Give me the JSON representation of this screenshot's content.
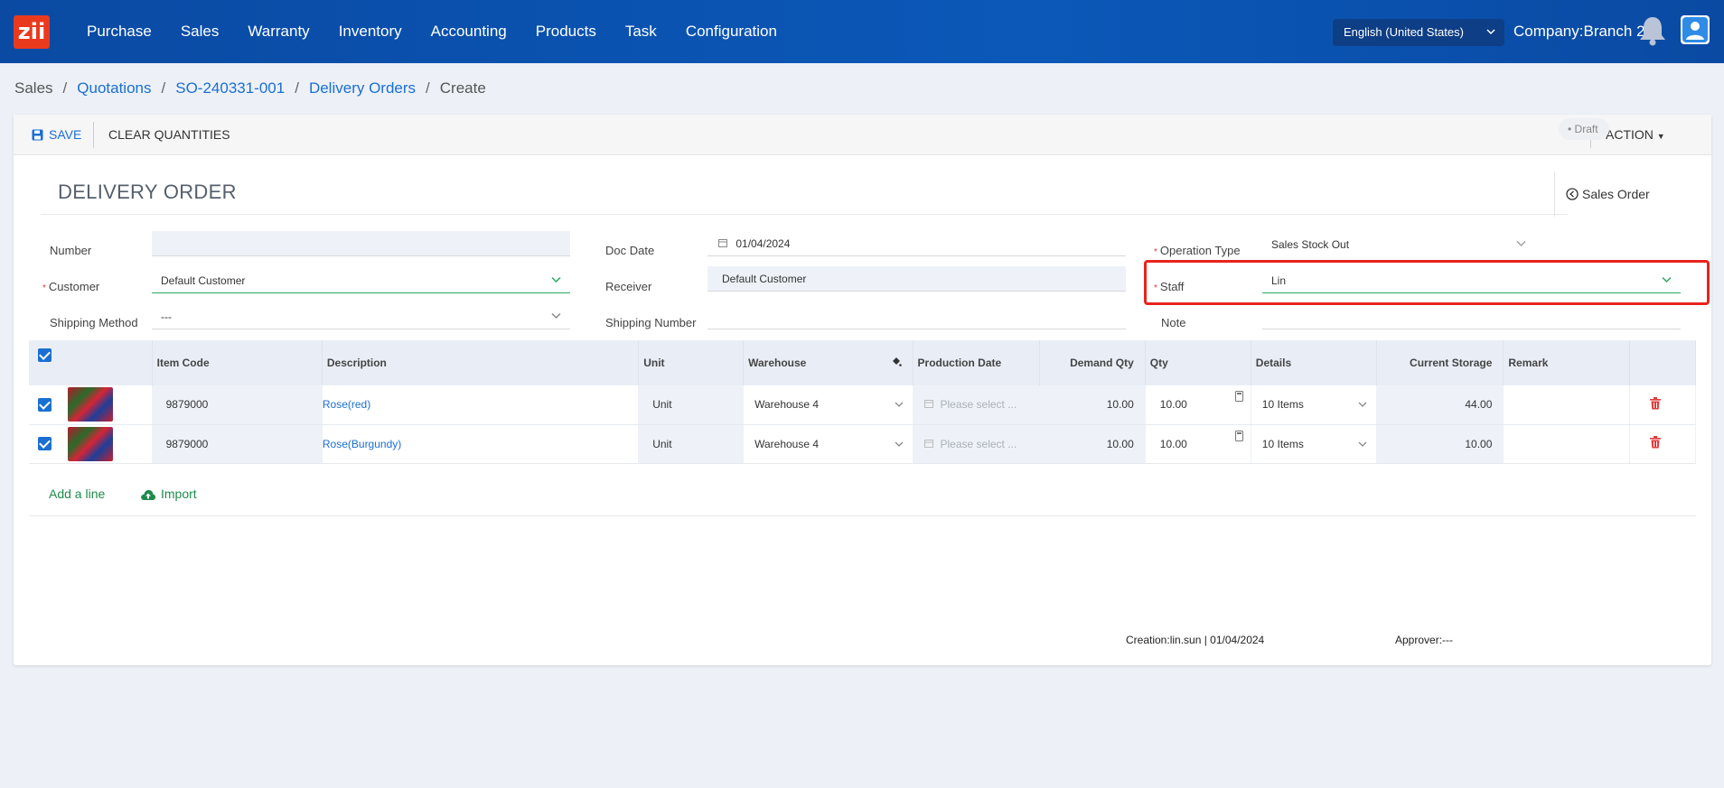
{
  "nav": {
    "logo": "zii",
    "items": [
      "Purchase",
      "Sales",
      "Warranty",
      "Inventory",
      "Accounting",
      "Products",
      "Task",
      "Configuration"
    ],
    "language": "English (United States)",
    "company": "Company:Branch 2"
  },
  "breadcrumb": [
    "Sales",
    "Quotations",
    "SO-240331-001",
    "Delivery Orders",
    "Create"
  ],
  "toolbar": {
    "save": "SAVE",
    "clear": "CLEAR QUANTITIES",
    "action": "ACTION"
  },
  "doc": {
    "title": "DELIVERY ORDER",
    "sales_order": "Sales Order",
    "status": "Draft"
  },
  "form": {
    "number": {
      "label": "Number",
      "value": ""
    },
    "customer": {
      "label": "Customer",
      "value": "Default Customer"
    },
    "shipping_method": {
      "label": "Shipping Method",
      "value": "---"
    },
    "doc_date": {
      "label": "Doc Date",
      "value": "01/04/2024"
    },
    "receiver": {
      "label": "Receiver",
      "value": "Default Customer"
    },
    "shipping_number": {
      "label": "Shipping Number",
      "value": ""
    },
    "operation_type": {
      "label": "Operation Type",
      "value": "Sales Stock Out"
    },
    "staff": {
      "label": "Staff",
      "value": "Lin"
    },
    "note": {
      "label": "Note",
      "value": ""
    }
  },
  "table": {
    "headers": [
      "Item Code",
      "Description",
      "Unit",
      "Warehouse",
      "Production Date",
      "Demand Qty",
      "Qty",
      "Details",
      "Current Storage",
      "Remark"
    ],
    "rows": [
      {
        "item_code": "9879000",
        "description": "Rose(red)",
        "unit": "Unit",
        "warehouse": "Warehouse 4",
        "production_date_placeholder": "Please select ...",
        "demand_qty": "10.00",
        "qty": "10.00",
        "details": "10 Items",
        "current_storage": "44.00",
        "remark": ""
      },
      {
        "item_code": "9879000",
        "description": "Rose(Burgundy)",
        "unit": "Unit",
        "warehouse": "Warehouse 4",
        "production_date_placeholder": "Please select ...",
        "demand_qty": "10.00",
        "qty": "10.00",
        "details": "10 Items",
        "current_storage": "10.00",
        "remark": ""
      }
    ],
    "add_line": "Add a line",
    "import": "Import"
  },
  "footer": {
    "creation": "Creation:lin.sun | 01/04/2024",
    "approver": "Approver:---"
  },
  "colors": {
    "nav_bg": "#0b52b0",
    "accent": "#1a6fd1",
    "green": "#1f8a4c",
    "danger": "#e23b3b",
    "highlight": "#e8231d"
  }
}
